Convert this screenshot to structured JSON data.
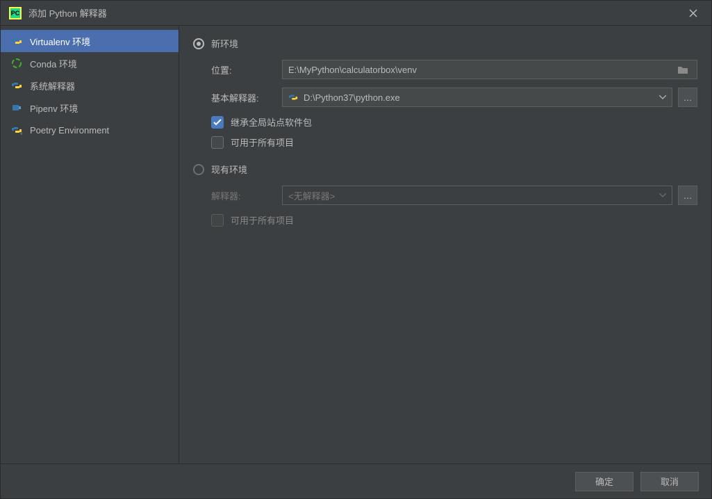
{
  "titlebar": {
    "title": "添加 Python 解释器"
  },
  "sidebar": {
    "items": [
      {
        "label": "Virtualenv 环境"
      },
      {
        "label": "Conda 环境"
      },
      {
        "label": "系统解释器"
      },
      {
        "label": "Pipenv 环境"
      },
      {
        "label": "Poetry Environment"
      }
    ]
  },
  "main": {
    "new_env_label": "新环境",
    "location_label": "位置:",
    "location_value": "E:\\MyPython\\calculatorbox\\venv",
    "base_label": "基本解释器:",
    "base_value": "D:\\Python37\\python.exe",
    "inherit_label": "继承全局站点软件包",
    "available_all_label": "可用于所有项目",
    "existing_env_label": "现有环境",
    "interpreter_label": "解释器:",
    "interpreter_value": "<无解释器>",
    "available_all_label2": "可用于所有项目"
  },
  "footer": {
    "ok": "确定",
    "cancel": "取消"
  }
}
